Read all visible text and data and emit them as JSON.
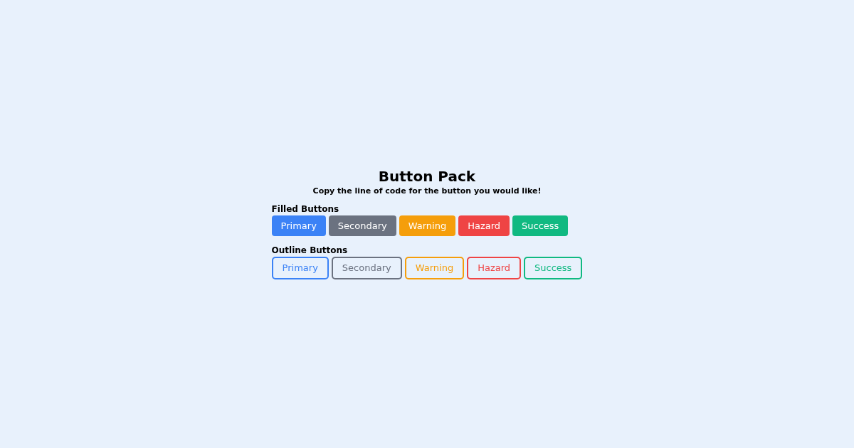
{
  "title": "Button Pack",
  "subtitle": "Copy the line of code for the button you would like!",
  "sections": [
    {
      "heading": "Filled Buttons",
      "kind": "filled",
      "buttons": [
        {
          "label": "Primary",
          "color": "#3b82f6"
        },
        {
          "label": "Secondary",
          "color": "#6b7280"
        },
        {
          "label": "Warning",
          "color": "#f59e0b"
        },
        {
          "label": "Hazard",
          "color": "#ef4444"
        },
        {
          "label": "Success",
          "color": "#10b981"
        }
      ]
    },
    {
      "heading": "Outline Buttons",
      "kind": "outline",
      "buttons": [
        {
          "label": "Primary",
          "color": "#3b82f6"
        },
        {
          "label": "Secondary",
          "color": "#6b7280"
        },
        {
          "label": "Warning",
          "color": "#f59e0b"
        },
        {
          "label": "Hazard",
          "color": "#ef4444"
        },
        {
          "label": "Success",
          "color": "#10b981"
        }
      ]
    }
  ]
}
